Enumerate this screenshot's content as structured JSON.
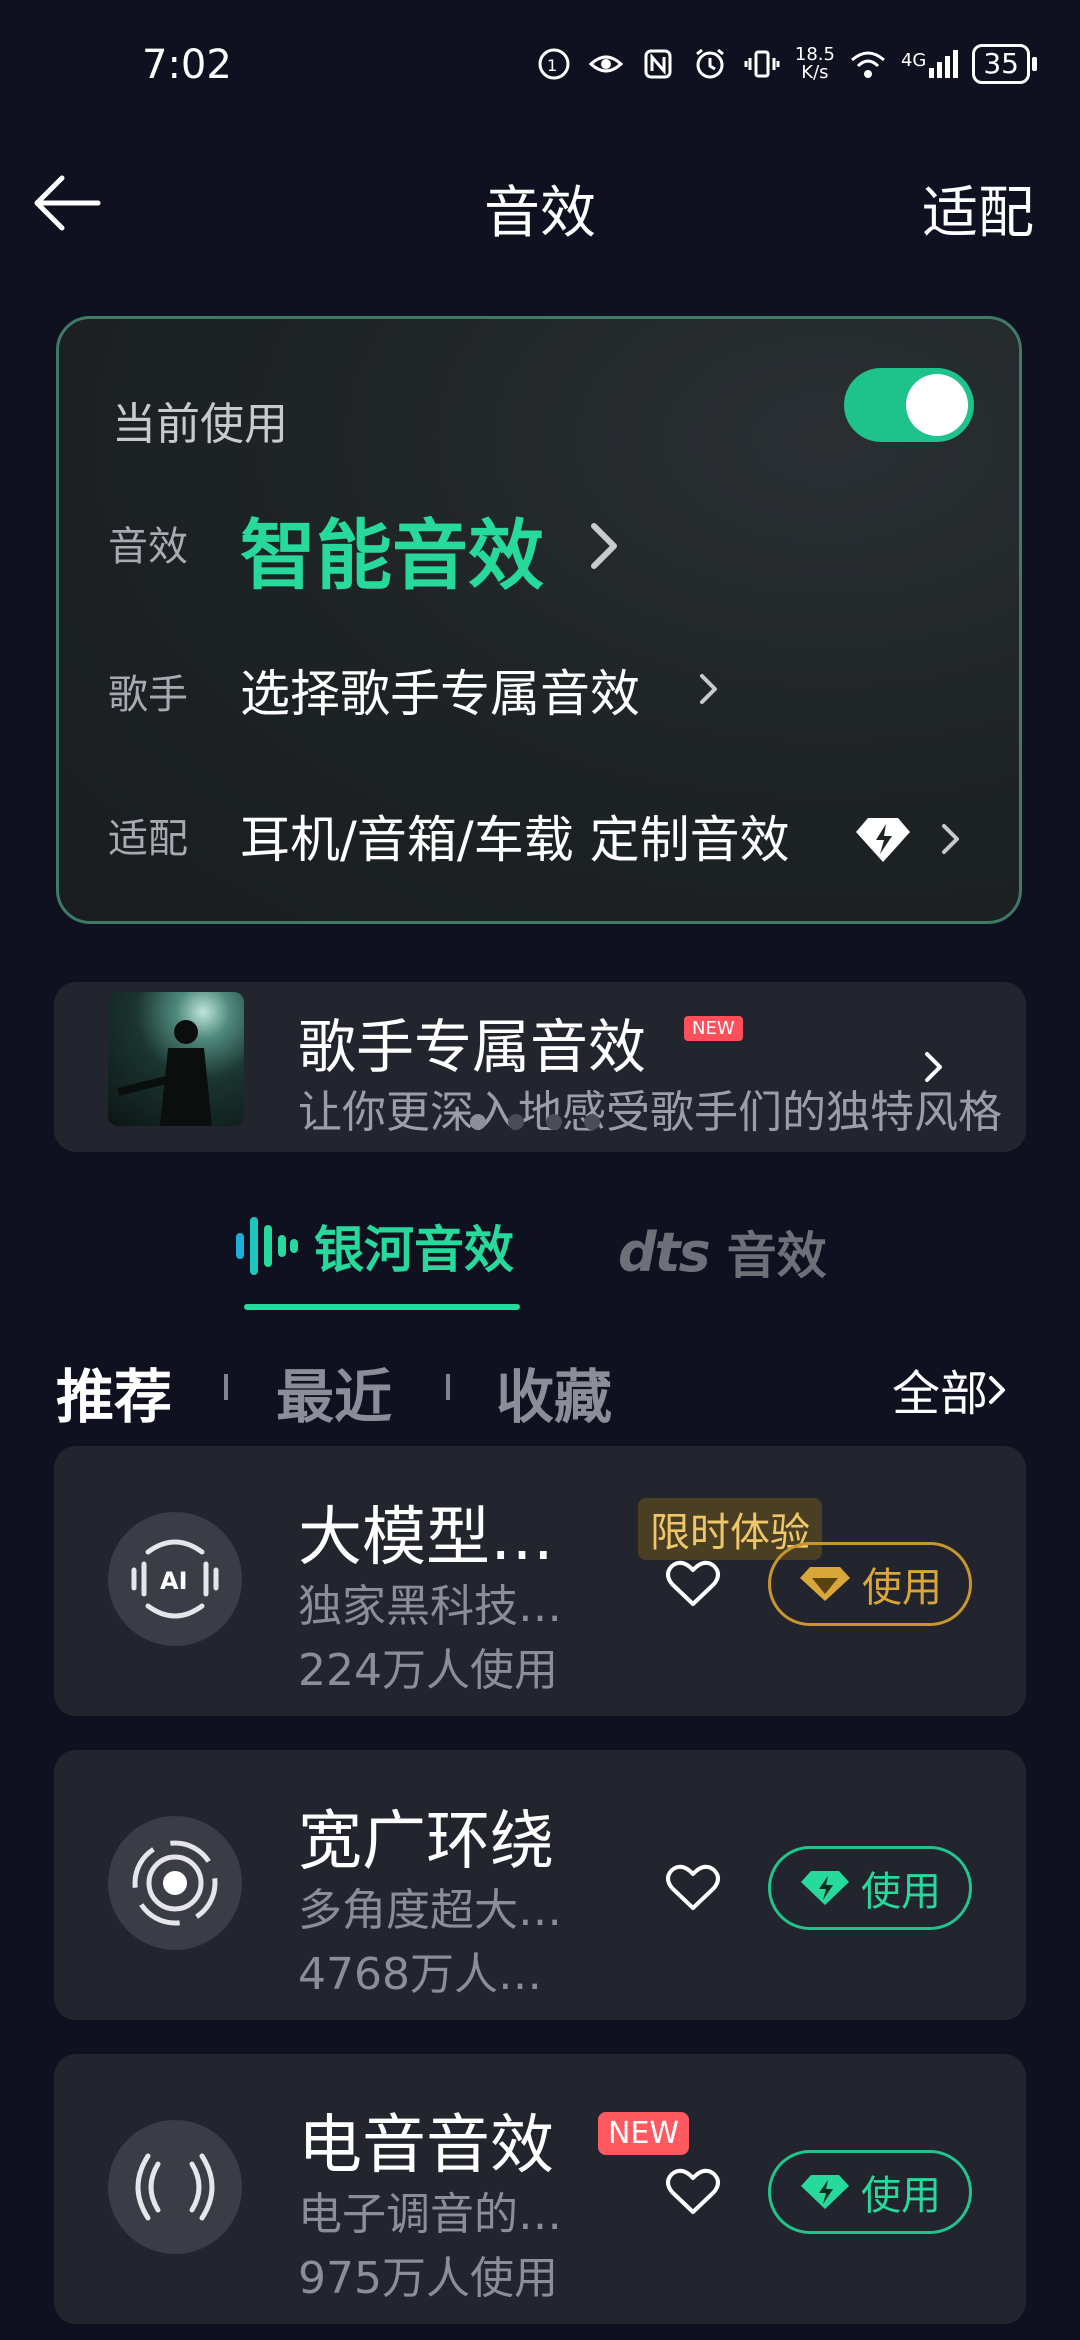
{
  "status": {
    "time": "7:02",
    "net_speed_value": "18.5",
    "net_speed_unit": "K/s",
    "network": "4G",
    "battery": "35"
  },
  "header": {
    "title": "音效",
    "right_action": "适配"
  },
  "current": {
    "label": "当前使用",
    "toggle_on": true,
    "effect_key": "音效",
    "effect_value": "智能音效",
    "singer_key": "歌手",
    "singer_value": "选择歌手专属音效",
    "fit_key": "适配",
    "fit_value": "耳机/音箱/车载 定制音效"
  },
  "banner": {
    "title": "歌手专属音效",
    "tag": "NEW",
    "subtitle": "让你更深入地感受歌手们的独特风格",
    "pages": 4,
    "active_page": 0
  },
  "tabs": [
    {
      "label": "银河音效",
      "active": true
    },
    {
      "label": "dts 音效",
      "brand": "dts",
      "suffix": "音效",
      "active": false
    }
  ],
  "filters": {
    "items": [
      "推荐",
      "最近",
      "收藏"
    ],
    "active_index": 0,
    "all_label": "全部"
  },
  "items": [
    {
      "title": "大模型…",
      "desc": "独家黑科技…",
      "count": "224万人使用",
      "tag": "限时体验",
      "button": "使用",
      "tier": "gold",
      "icon": "ai-wave-icon"
    },
    {
      "title": "宽广环绕",
      "desc": "多角度超大…",
      "count": "4768万人…",
      "button": "使用",
      "tier": "green",
      "icon": "surround-icon"
    },
    {
      "title": "电音音效",
      "desc": "电子调音的…",
      "count": "975万人使用",
      "tag": "NEW",
      "button": "使用",
      "tier": "green",
      "icon": "electronic-icon"
    }
  ],
  "colors": {
    "background": "#0f1120",
    "accent": "#27d99b",
    "gold": "#d9a63a",
    "card": "#22252e",
    "new_tag": "#ff5a5f"
  }
}
